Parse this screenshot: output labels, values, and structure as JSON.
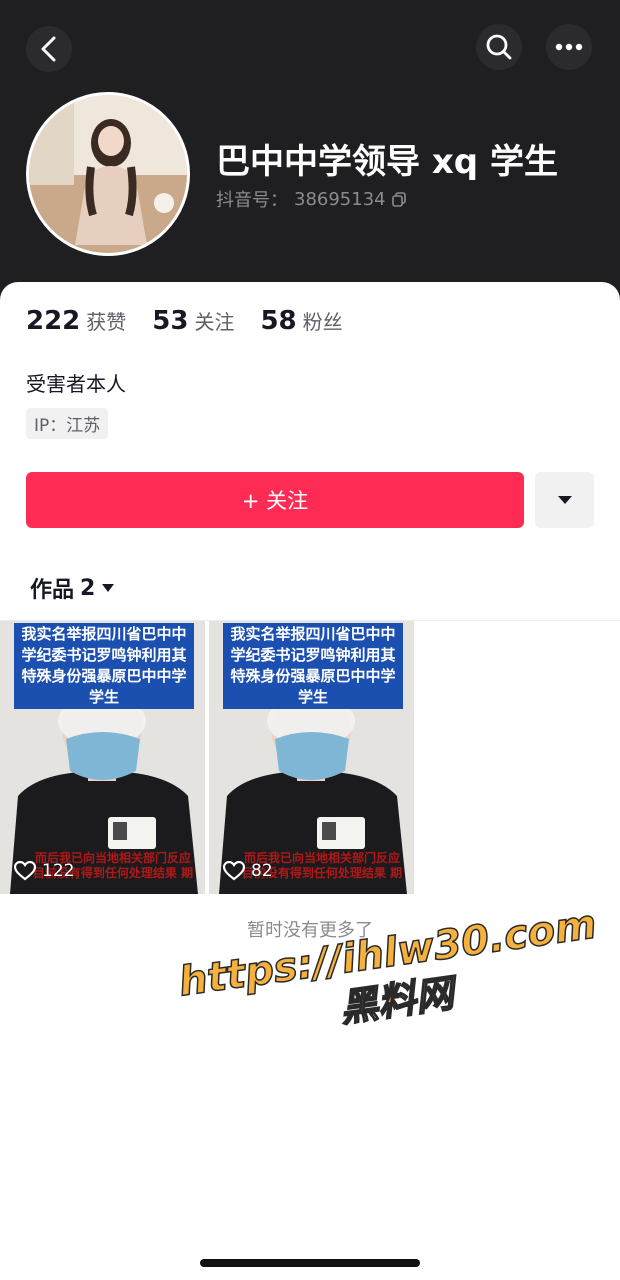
{
  "header": {
    "back_icon": "chevron-left-icon",
    "search_icon": "search-icon",
    "more_icon": "more-horizontal-icon"
  },
  "profile": {
    "name": "巴中中学领导 xq 学生",
    "douyin_id_label": "抖音号：",
    "douyin_id": "38695134",
    "copy_icon": "copy-icon",
    "bio": "受害者本人",
    "ip": "IP：江苏"
  },
  "stats": [
    {
      "num": "222",
      "label": "获赞"
    },
    {
      "num": "53",
      "label": "关注"
    },
    {
      "num": "58",
      "label": "粉丝"
    }
  ],
  "actions": {
    "follow_label": "+ 关注",
    "dropdown_icon": "triangle-down-icon",
    "follow_color": "#fe2c55"
  },
  "works": {
    "tab_label": "作品",
    "count": "2",
    "items": [
      {
        "caption": "我实名举报四川省巴中中学纪委书记罗鸣钟利用其特殊身份强暴原巴中中学学生",
        "bottom_caption": "而后我已向当地相关部门反应 目前没有得到任何处理结果 期",
        "likes": "122"
      },
      {
        "caption": "我实名举报四川省巴中中学纪委书记罗鸣钟利用其特殊身份强暴原巴中中学学生",
        "bottom_caption": "而后我已向当地相关部门反应 目前没有得到任何处理结果 期",
        "likes": "82"
      }
    ]
  },
  "footer": {
    "no_more": "暂时没有更多了"
  },
  "watermark": {
    "line1": "https://ihlw30.com",
    "line2": "黑料网"
  }
}
